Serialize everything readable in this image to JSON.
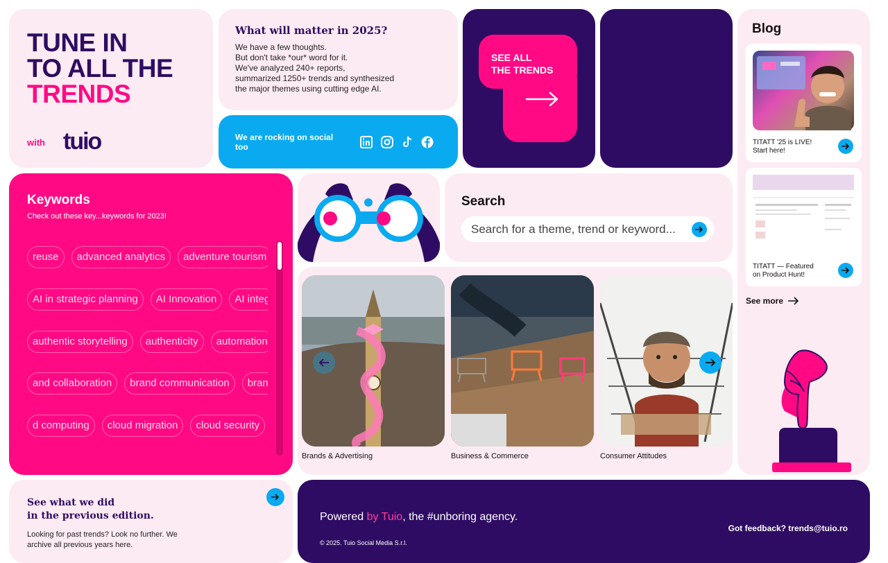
{
  "hero": {
    "line1": "TUNE IN",
    "line2": "TO ALL THE",
    "line3": "TRENDS",
    "with": "with",
    "logo": "tuio"
  },
  "matter": {
    "title": "What will matter in 2025?",
    "lines": [
      "We have a few thoughts.",
      "But don't take *our* word for it.",
      "We've analyzed 240+ reports,",
      "summarized 1250+ trends and synthesized",
      "the major themes using cutting edge AI."
    ]
  },
  "social": {
    "label": "We are rocking on social too",
    "icons": [
      "linkedin-icon",
      "instagram-icon",
      "tiktok-icon",
      "facebook-icon"
    ]
  },
  "see_all": {
    "line1": "SEE ALL",
    "line2": "THE TRENDS"
  },
  "blog": {
    "title": "Blog",
    "posts": [
      {
        "caption": "TITATT '25 is LIVE! Start here!"
      },
      {
        "caption": "TITATT — Featured on Product Hunt!"
      }
    ],
    "see_more": "See more"
  },
  "keywords": {
    "title": "Keywords",
    "subtitle": "Check out these key...keywords for 2023!",
    "rows": [
      [
        "reuse",
        "advanced analytics",
        "adventure tourism"
      ],
      [
        "AI in strategic planning",
        "AI Innovation",
        "AI integ"
      ],
      [
        "authentic storytelling",
        "authenticity",
        "automation"
      ],
      [
        "and collaboration",
        "brand communication",
        "brand"
      ],
      [
        "d computing",
        "cloud migration",
        "cloud security"
      ]
    ]
  },
  "search": {
    "title": "Search",
    "placeholder": "Search for a theme, trend or keyword..."
  },
  "categories": [
    {
      "label": "Brands & Advertising"
    },
    {
      "label": "Business & Commerce"
    },
    {
      "label": "Consumer Attitudes"
    }
  ],
  "previous": {
    "line1": "See what we did",
    "line2": "in the previous edition.",
    "body": "Looking for past trends? Look no further. We archive all previous years here."
  },
  "footer": {
    "powered_pre": "Powered ",
    "powered_by": "by Tuio",
    "powered_post": ", the #unboring agency.",
    "copyright": "© 2025. Tuio Social Media S.r.l.",
    "feedback": "Got feedback? trends@tuio.ro"
  },
  "colors": {
    "purple": "#2f0c63",
    "hot_pink": "#ff0a84",
    "light_pink": "#fdebf3",
    "cyan": "#0aaaf0"
  }
}
